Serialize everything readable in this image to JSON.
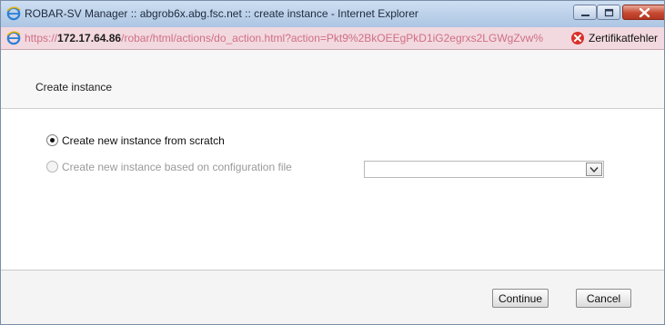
{
  "window": {
    "title": "ROBAR-SV Manager :: abgrob6x.abg.fsc.net :: create instance - Internet Explorer",
    "controls": {
      "minimize": "minimize-icon",
      "maximize": "maximize-icon",
      "close": "close-icon"
    }
  },
  "address_bar": {
    "scheme": "https://",
    "host": "172.17.64.86",
    "path": "/robar/html/actions/do_action.html?action=Pkt9%2BkOEEgPkD1iG2egrxs2LGWgZvw%",
    "certificate_label": "Zertifikatfehler",
    "icon": "ie-icon",
    "error_icon": "certificate-error-icon"
  },
  "dialog": {
    "title": "Create instance",
    "options": [
      {
        "label": "Create new instance from scratch",
        "selected": true,
        "enabled": true
      },
      {
        "label": "Create new instance based on configuration file",
        "selected": false,
        "enabled": false
      }
    ],
    "config_file_select": {
      "value": ""
    },
    "buttons": {
      "continue": "Continue",
      "cancel": "Cancel"
    }
  },
  "colors": {
    "titlebar": "#bcd1ea",
    "addressbar_error_bg": "#f2d9df",
    "url_text": "#cf6f85",
    "close_button": "#c74a32"
  }
}
